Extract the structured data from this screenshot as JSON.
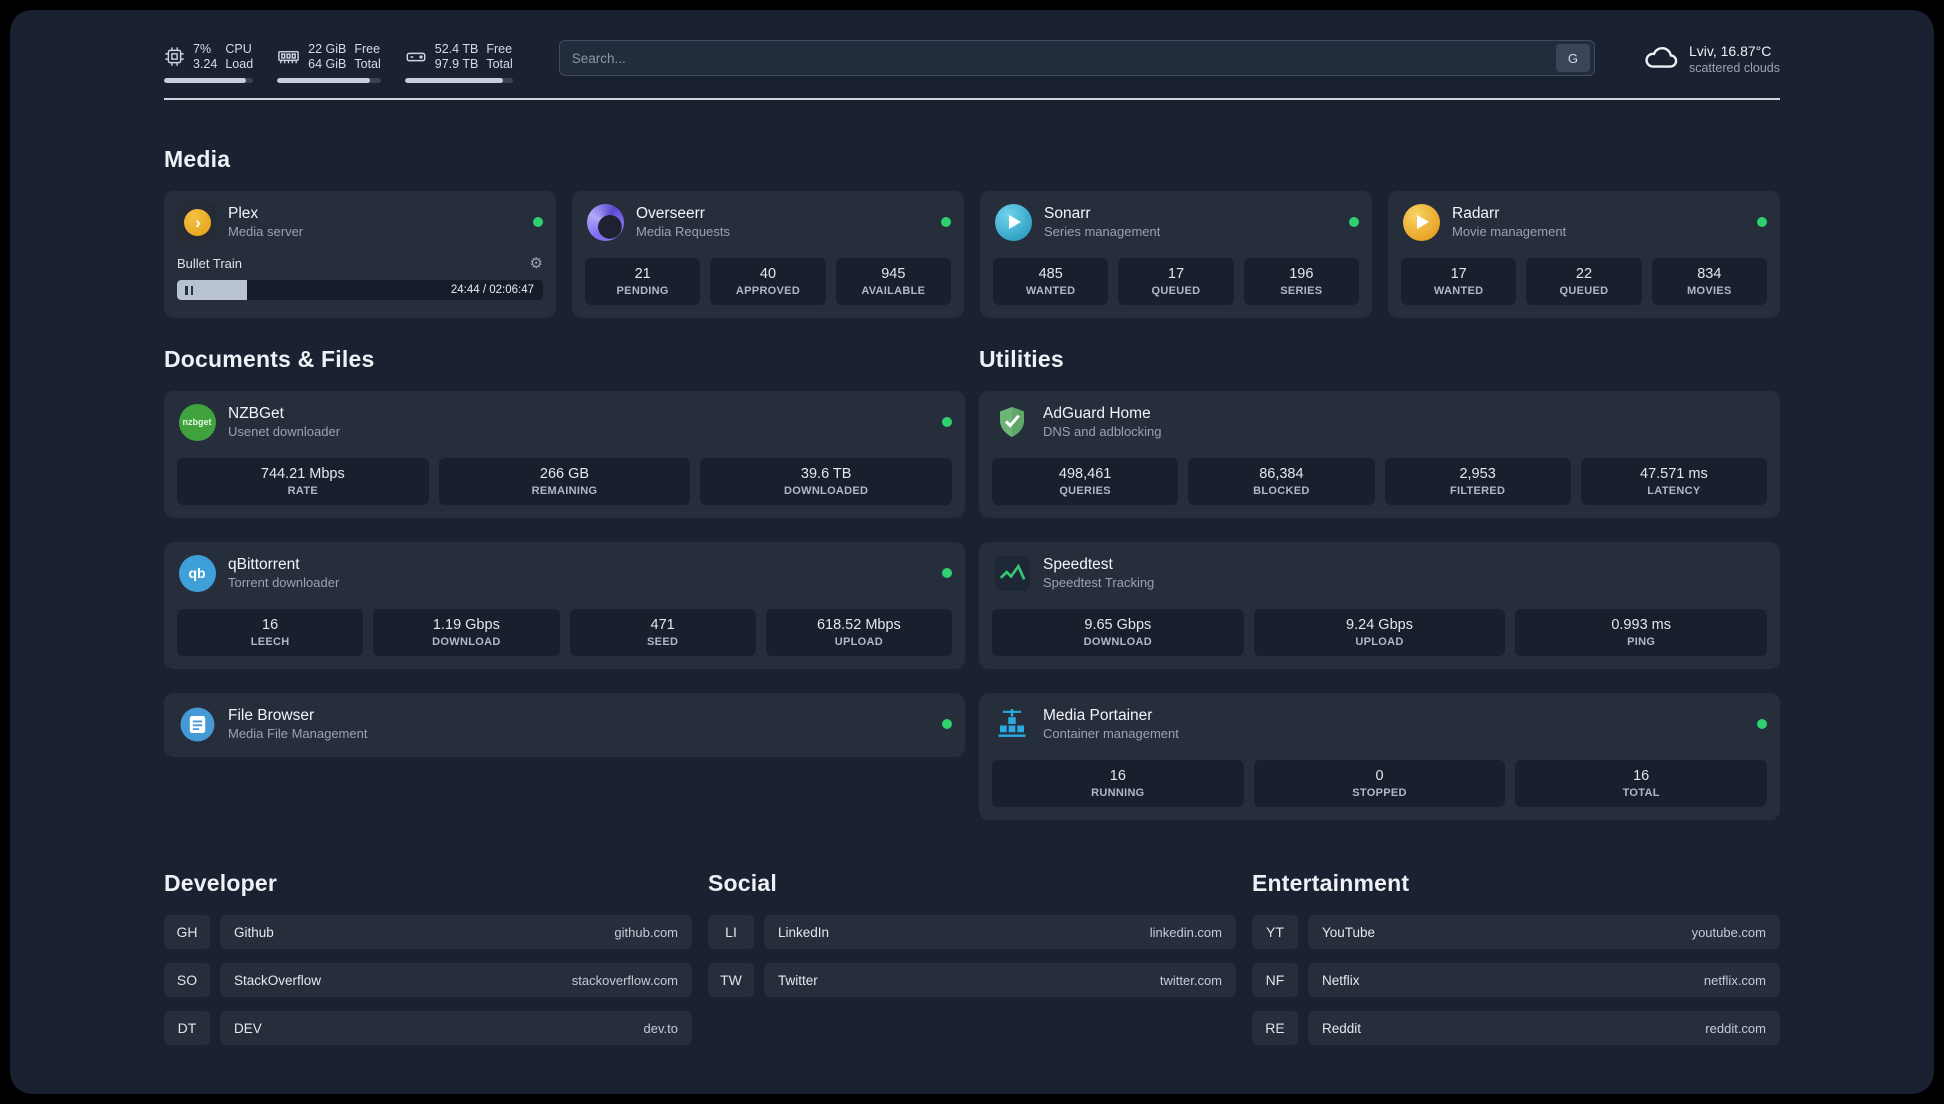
{
  "topbar": {
    "cpu": {
      "line1": "7%",
      "line2": "3.24",
      "label1": "CPU",
      "label2": "Load",
      "bar": 92
    },
    "memory": {
      "line1": "22 GiB",
      "line2": "64 GiB",
      "label1": "Free",
      "label2": "Total",
      "bar": 90
    },
    "disk": {
      "line1": "52.4 TB",
      "line2": "97.9 TB",
      "label1": "Free",
      "label2": "Total",
      "bar": 91
    },
    "search": {
      "placeholder": "Search...",
      "button": "G"
    },
    "weather": {
      "location": "Lviv, 16.87°C",
      "condition": "scattered clouds"
    }
  },
  "sections": {
    "media": {
      "title": "Media",
      "plex": {
        "name": "Plex",
        "desc": "Media server",
        "now_playing": "Bullet Train",
        "time": "24:44 / 02:06:47",
        "progress_percent": 19
      },
      "overseerr": {
        "name": "Overseerr",
        "desc": "Media Requests",
        "stats": [
          {
            "value": "21",
            "label": "PENDING"
          },
          {
            "value": "40",
            "label": "APPROVED"
          },
          {
            "value": "945",
            "label": "AVAILABLE"
          }
        ]
      },
      "sonarr": {
        "name": "Sonarr",
        "desc": "Series management",
        "stats": [
          {
            "value": "485",
            "label": "WANTED"
          },
          {
            "value": "17",
            "label": "QUEUED"
          },
          {
            "value": "196",
            "label": "SERIES"
          }
        ]
      },
      "radarr": {
        "name": "Radarr",
        "desc": "Movie management",
        "stats": [
          {
            "value": "17",
            "label": "WANTED"
          },
          {
            "value": "22",
            "label": "QUEUED"
          },
          {
            "value": "834",
            "label": "MOVIES"
          }
        ]
      }
    },
    "documents": {
      "title": "Documents & Files",
      "nzbget": {
        "name": "NZBGet",
        "desc": "Usenet downloader",
        "stats": [
          {
            "value": "744.21 Mbps",
            "label": "RATE"
          },
          {
            "value": "266 GB",
            "label": "REMAINING"
          },
          {
            "value": "39.6 TB",
            "label": "DOWNLOADED"
          }
        ]
      },
      "qbittorrent": {
        "name": "qBittorrent",
        "desc": "Torrent downloader",
        "stats": [
          {
            "value": "16",
            "label": "LEECH"
          },
          {
            "value": "1.19 Gbps",
            "label": "DOWNLOAD"
          },
          {
            "value": "471",
            "label": "SEED"
          },
          {
            "value": "618.52 Mbps",
            "label": "UPLOAD"
          }
        ]
      },
      "filebrowser": {
        "name": "File Browser",
        "desc": "Media File Management"
      }
    },
    "utilities": {
      "title": "Utilities",
      "adguard": {
        "name": "AdGuard Home",
        "desc": "DNS and adblocking",
        "stats": [
          {
            "value": "498,461",
            "label": "QUERIES"
          },
          {
            "value": "86,384",
            "label": "BLOCKED"
          },
          {
            "value": "2,953",
            "label": "FILTERED"
          },
          {
            "value": "47.571 ms",
            "label": "LATENCY"
          }
        ]
      },
      "speedtest": {
        "name": "Speedtest",
        "desc": "Speedtest Tracking",
        "stats": [
          {
            "value": "9.65 Gbps",
            "label": "DOWNLOAD"
          },
          {
            "value": "9.24 Gbps",
            "label": "UPLOAD"
          },
          {
            "value": "0.993 ms",
            "label": "PING"
          }
        ]
      },
      "portainer": {
        "name": "Media Portainer",
        "desc": "Container management",
        "stats": [
          {
            "value": "16",
            "label": "RUNNING"
          },
          {
            "value": "0",
            "label": "STOPPED"
          },
          {
            "value": "16",
            "label": "TOTAL"
          }
        ]
      }
    }
  },
  "bookmarks": [
    {
      "title": "Developer",
      "items": [
        {
          "abbr": "GH",
          "name": "Github",
          "url": "github.com"
        },
        {
          "abbr": "SO",
          "name": "StackOverflow",
          "url": "stackoverflow.com"
        },
        {
          "abbr": "DT",
          "name": "DEV",
          "url": "dev.to"
        }
      ]
    },
    {
      "title": "Social",
      "items": [
        {
          "abbr": "LI",
          "name": "LinkedIn",
          "url": "linkedin.com"
        },
        {
          "abbr": "TW",
          "name": "Twitter",
          "url": "twitter.com"
        }
      ]
    },
    {
      "title": "Entertainment",
      "items": [
        {
          "abbr": "YT",
          "name": "YouTube",
          "url": "youtube.com"
        },
        {
          "abbr": "NF",
          "name": "Netflix",
          "url": "netflix.com"
        },
        {
          "abbr": "RE",
          "name": "Reddit",
          "url": "reddit.com"
        }
      ]
    }
  ],
  "icons": {
    "plex_chevron": "›",
    "gear": "⚙",
    "nzbget_text": "nzbget",
    "qbittorrent_text": "qb"
  },
  "colors": {
    "status_green": "#2fd06e",
    "plex_amber": "#e5a00d"
  }
}
